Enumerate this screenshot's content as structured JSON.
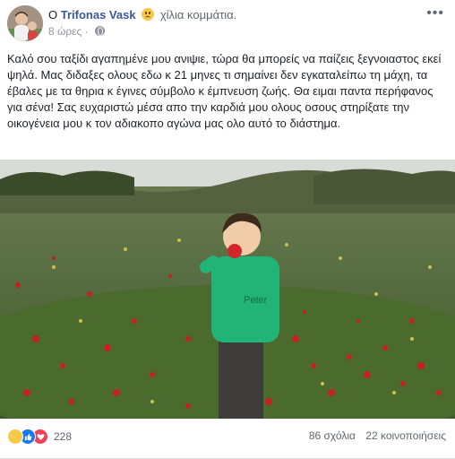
{
  "post": {
    "author_prefix": "O",
    "author_name": "Trifonas Vask",
    "feeling_text": "χίλια κομμάτια.",
    "timestamp": "8 ώρες ·",
    "more_label": "•••",
    "text": "Καλό σου ταξίδι αγαπημένε μου ανιψιε, τώρα θα μπορείς να παίζεις ξεγνοιαστος εκεί ψηλά. Μας διδαξες ολους εδω κ 21 μηνες τι σημαίνει δεν εγκαταλείπω τη μάχη, τα έβαλες με τα θηρια κ έγινες σύμβολο κ έμπνευση ζωής. Θα ειμαι παντα περήφανος για σένα! Σας ευχαριστώ μέσα απο την καρδιά μου ολους οσους στηρίξατε την οικογένεια μου κ τον αδιακοπο αγώνα μας ολο αυτό το διάστημα."
  },
  "photo": {
    "shirt_text": "Peter"
  },
  "footer": {
    "reaction_count": "228",
    "comments": "86 σχόλια",
    "shares": "22 κοινοποιήσεις",
    "reaction_icons": [
      "sad-icon",
      "like-icon",
      "love-icon"
    ],
    "colors": {
      "like": "#1877f2",
      "love": "#f33e58",
      "sad": "#f7c948",
      "name": "#385898"
    }
  }
}
